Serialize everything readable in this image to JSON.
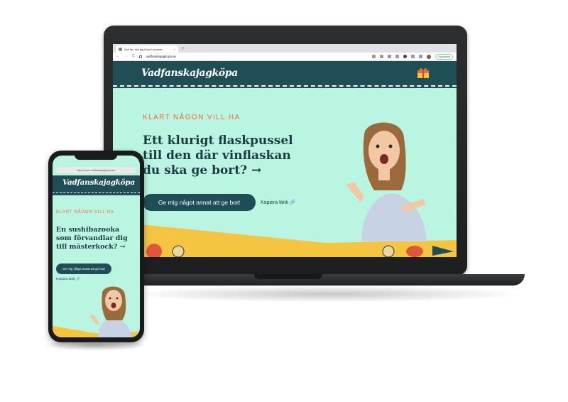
{
  "browser": {
    "tab_title": "Vad fan ska jag köpa i present",
    "tab_close": "×",
    "tab_add": "+",
    "url": "vadfanskajagkopa.se",
    "nav_back": "←",
    "nav_forward": "→",
    "nav_reload": "C",
    "profile_label": "Uppdatera"
  },
  "site": {
    "logo": "Vadfanskajagköpa",
    "eyebrow": "KLART NÅGON VILL HA",
    "headline": "Ett klurigt flaskpussel till den där vinflaskan du ska ge bort? →",
    "cta": "Ge mig något annat att ge bort",
    "copy_link": "Kopiera länk 🔗"
  },
  "phone": {
    "url": "https://www.vadfanskajagkopa.se/",
    "logo": "Vadfanskajagköpa",
    "eyebrow": "KLART NÅGON VILL HA",
    "headline": "En sushibazooka som förvandlar dig till mästerkock? →",
    "cta": "Ge mig något annat att ge bort",
    "copy_link": "Kopiera länk 🔗"
  },
  "colors": {
    "header_bg": "#1f4e57",
    "hero_bg": "#b9f5e0",
    "accent": "#f26b3a",
    "yellow": "#f5c542",
    "text_dark": "#1d3b44"
  }
}
